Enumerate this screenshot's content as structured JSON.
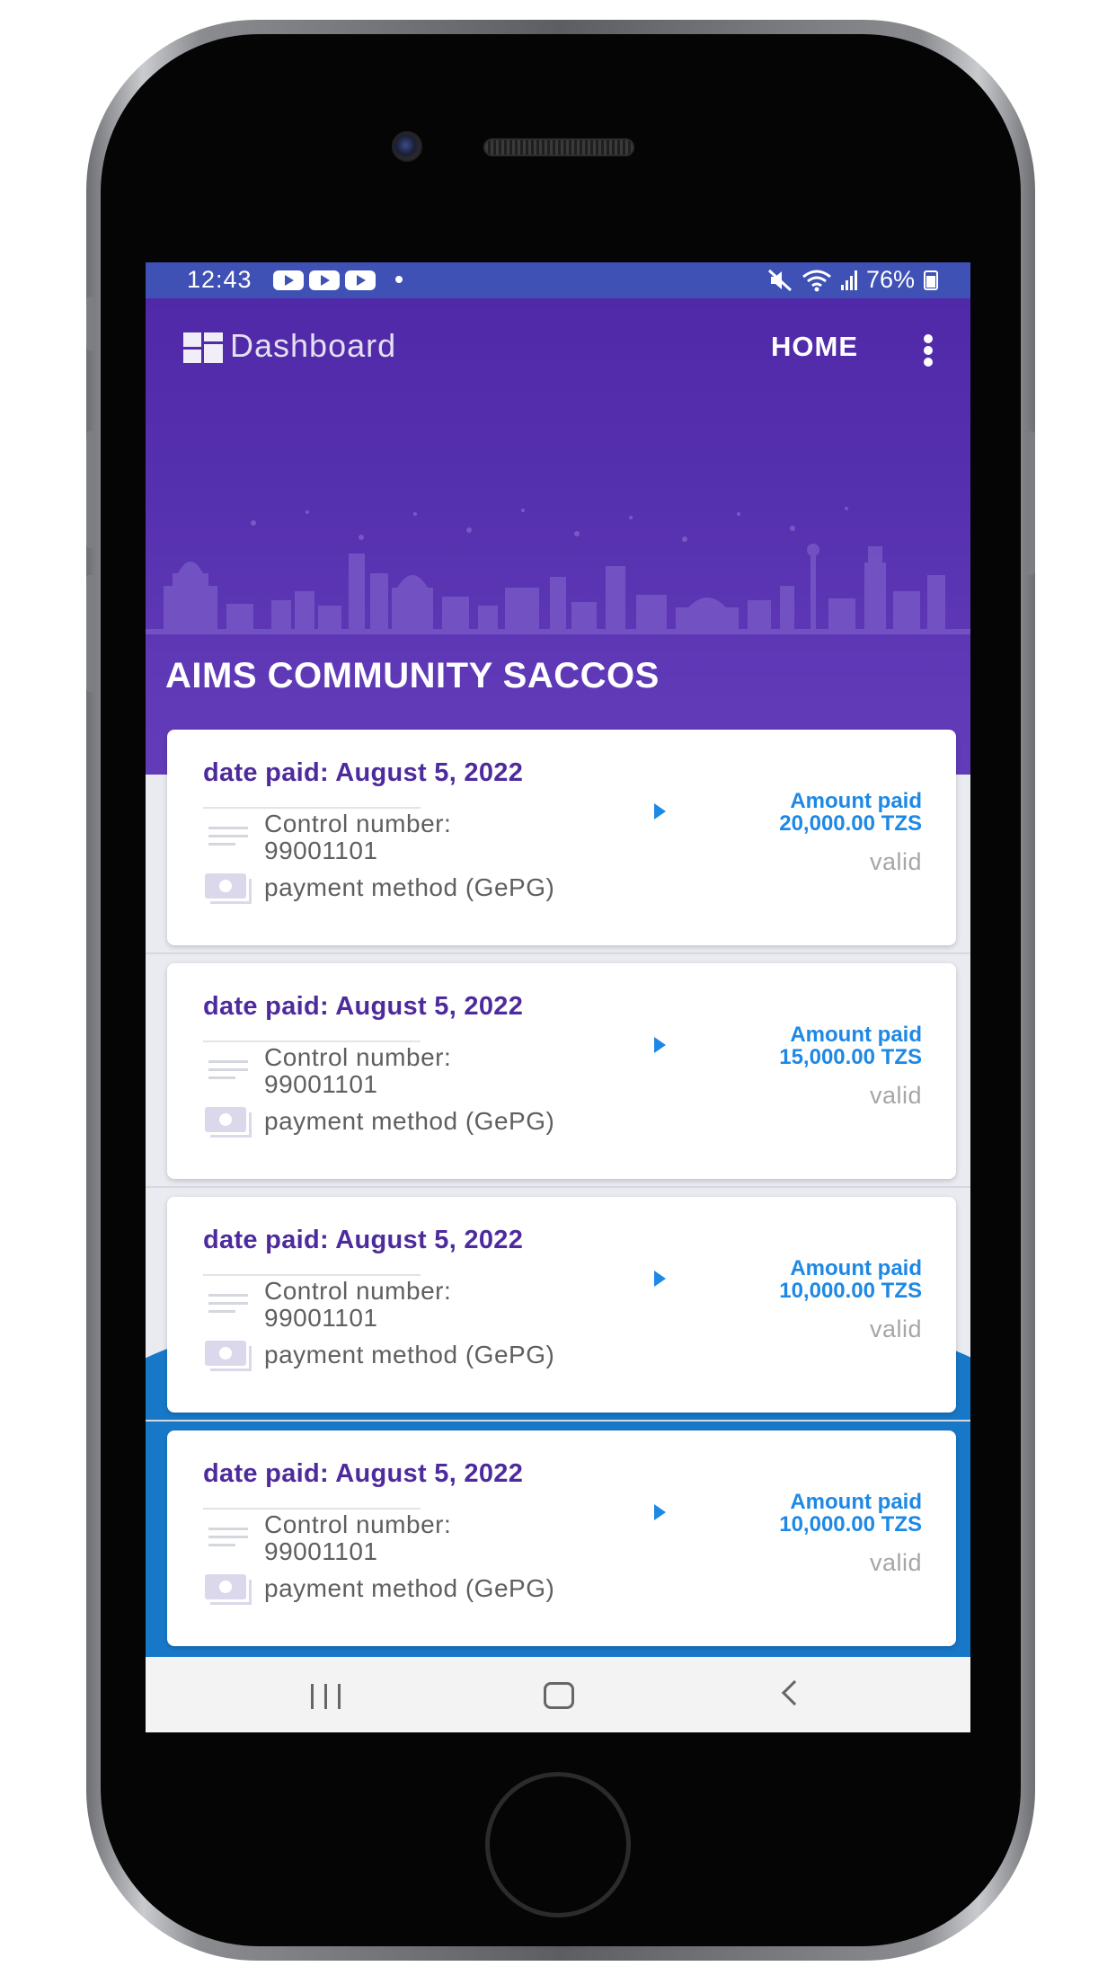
{
  "status_bar": {
    "time": "12:43",
    "battery": "76%",
    "notification_icons": [
      "youtube-icon",
      "youtube-icon",
      "youtube-icon"
    ],
    "right_icons": [
      "mute-icon",
      "wifi-icon",
      "signal-icon",
      "battery-icon"
    ]
  },
  "toolbar": {
    "title": "Dashboard",
    "home_label": "HOME",
    "menu_icon": "more-vert-icon",
    "title_icon": "dashboard-icon"
  },
  "header": {
    "org_name": "AIMS COMMUNITY SACCOS"
  },
  "payments": [
    {
      "date_paid": "date paid: August 5, 2022",
      "control_label": "Control number:",
      "control_number": "99001101",
      "method": "payment method (GePG)",
      "amount_label": "Amount paid",
      "amount": "20,000.00 TZS",
      "status": "valid"
    },
    {
      "date_paid": "date paid: August 5, 2022",
      "control_label": "Control number:",
      "control_number": "99001101",
      "method": "payment method (GePG)",
      "amount_label": "Amount paid",
      "amount": "15,000.00 TZS",
      "status": "valid"
    },
    {
      "date_paid": "date paid: August 5, 2022",
      "control_label": "Control number:",
      "control_number": "99001101",
      "method": "payment method (GePG)",
      "amount_label": "Amount paid",
      "amount": "10,000.00 TZS",
      "status": "valid"
    },
    {
      "date_paid": "date paid: August 5, 2022",
      "control_label": "Control number:",
      "control_number": "99001101",
      "method": "payment method (GePG)",
      "amount_label": "Amount paid",
      "amount": "10,000.00 TZS",
      "status": "valid"
    }
  ],
  "nav_bar": {
    "buttons": [
      "recent-apps-icon",
      "home-icon",
      "back-icon"
    ]
  },
  "colors": {
    "app_bar": "#5029a8",
    "status_bar": "#3f51b5",
    "accent_blue": "#1e88e5",
    "date_text": "#4e2b9c",
    "status_text": "#a6a6a6"
  }
}
